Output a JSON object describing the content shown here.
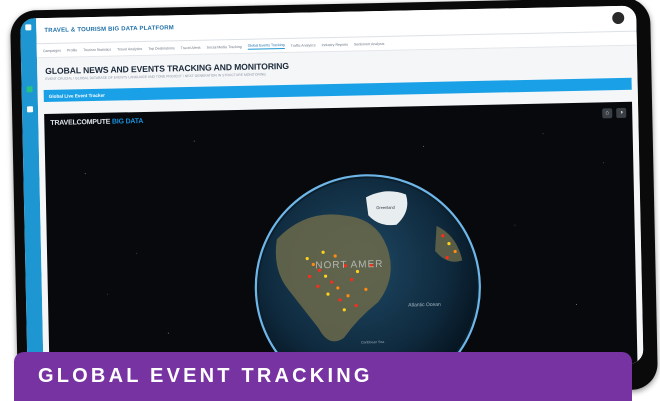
{
  "app": {
    "brand": "TRAVEL & TOURISM BIG DATA PLATFORM"
  },
  "nav": {
    "tabs": [
      {
        "label": "Campaigns"
      },
      {
        "label": "Profile"
      },
      {
        "label": "Tourism Statistics"
      },
      {
        "label": "Travel Analytics"
      },
      {
        "label": "Top Destinations"
      },
      {
        "label": "Travel Alerts"
      },
      {
        "label": "Social Media Tracking"
      },
      {
        "label": "Global Events Tracking"
      },
      {
        "label": "Traffic Analytics"
      },
      {
        "label": "Industry Reports"
      },
      {
        "label": "Sentiment Analysis"
      }
    ],
    "active": "Global Events Tracking"
  },
  "page": {
    "title": "GLOBAL NEWS AND EVENTS TRACKING AND MONITORING",
    "subtitle": "EVENT CRUCIAL / GLOBAL DATABASE OF EVENTS LANGUAGE AND TONE PROJECT / NEXT GENERATION IN STRUCTURE MONITORING"
  },
  "tracker": {
    "header": "Global Live Event Tracker",
    "brand_main": "TRAVELCOMPUTE",
    "brand_accent": "BIG DATA"
  },
  "globe": {
    "labels": {
      "north_america": "NORT AMER",
      "greenland": "Greenland",
      "atlantic": "Atlantic Ocean",
      "caribbean": "Caribbean Sea"
    }
  },
  "caption": {
    "text": "GLOBAL EVENT TRACKING"
  },
  "colors": {
    "sidebar": "#1d96d2",
    "tracker_bar": "#1aa0e6",
    "caption_bg": "#7833a2",
    "event_dots": [
      "#ff2a1a",
      "#ff8a10",
      "#ffd21a"
    ]
  },
  "icons": {
    "home": "home-icon",
    "globe": "globe-icon"
  }
}
